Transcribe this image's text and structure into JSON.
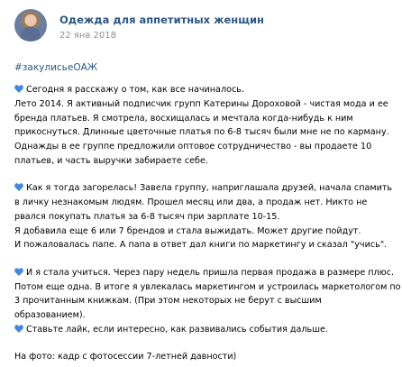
{
  "group": {
    "name": "Одежда для аппетитных женщин",
    "date": "22 янв 2018"
  },
  "post": {
    "hashtag": "#закулисьеОАЖ",
    "heart_color": "#3f8ae0",
    "paragraphs": [
      {
        "lines": [
          "Сегодня я расскажу о том, как все начиналось.",
          "Лето 2014. Я активный подписчик групп Катерины Дороховой - чистая мода и ее",
          "бренда платьев. Я смотрела, восхищалась и мечтала когда-нибудь к ним",
          "прикоснуться. Длинные цветочные платья по 6-8 тысяч были мне не по карману.",
          "Однажды в ее группе предложили оптовое сотрудничество - вы продаете 10",
          "платьев, и часть выручки забираете себе."
        ]
      },
      {
        "lines": [
          "Как я тогда загорелась! Завела группу, напригла­шала друзей, начала спамить",
          "в личку незнакомым людям. Прошел месяц или два, а продаж нет. Никто не",
          "рвался покупать платья за 6-8 тысяч при зарплате 10-15.",
          "Я добавила еще 6 или 7 брендов и стала выжидать. Может другие пойдут.",
          "И пожаловалась папе. А папа в ответ дал книги по маркетингу и сказал \"учись\"."
        ]
      },
      {
        "lines": [
          "И я стала учиться. Через пару недель пришла первая продажа в размере плюс.",
          "Потом еще одна. В итоге я увлекалась маркетингом и устроилась маркетологом по",
          "3 прочитанным книжкам. (При этом некоторых не берут с высшим",
          "образованием).",
          "Ставьте лайк, если интересно, как развивались события дальше."
        ]
      },
      {
        "lines": [
          "На фото: кадр с фотосессии 7-летней давности)"
        ]
      }
    ]
  }
}
